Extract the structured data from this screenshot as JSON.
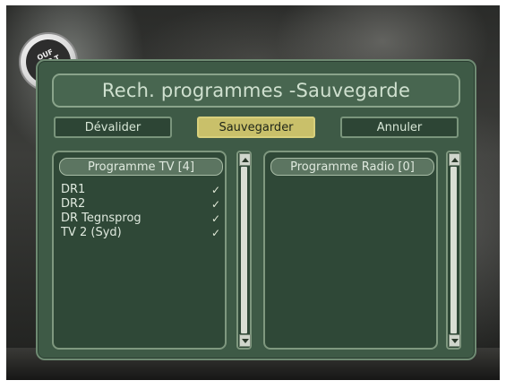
{
  "logo": {
    "text": "OUF\nDVB-T\nTEST"
  },
  "dialog": {
    "title": "Rech. programmes -Sauvegarde",
    "buttons": {
      "devalidate": "Dévalider",
      "save": "Sauvegarder",
      "cancel": "Annuler"
    },
    "tv_panel": {
      "header": "Programme TV [4]",
      "items": [
        {
          "name": "DR1",
          "check": "✓"
        },
        {
          "name": "DR2",
          "check": "✓"
        },
        {
          "name": "DR Tegnsprog",
          "check": "✓"
        },
        {
          "name": "TV 2 (Syd)",
          "check": "✓"
        }
      ]
    },
    "radio_panel": {
      "header": "Programme Radio  [0]",
      "items": []
    },
    "active_button": "save"
  },
  "colors": {
    "dialog_bg": "#3e5a46",
    "active_button": "#c9c06a",
    "text": "#dfe9de"
  },
  "icons": {
    "scroll_up": "triangle-up",
    "scroll_down": "triangle-down",
    "check": "checkmark"
  }
}
